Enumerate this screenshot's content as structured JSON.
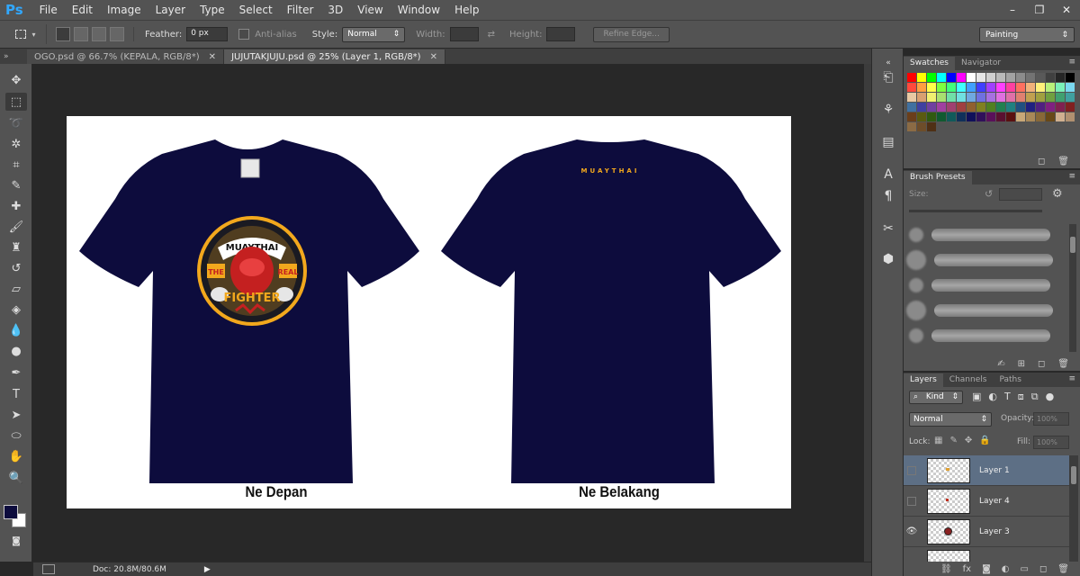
{
  "app": {
    "logo": "Ps"
  },
  "menu": [
    "File",
    "Edit",
    "Image",
    "Layer",
    "Type",
    "Select",
    "Filter",
    "3D",
    "View",
    "Window",
    "Help"
  ],
  "window_controls": {
    "minimize": "–",
    "restore": "❐",
    "close": "✕"
  },
  "options": {
    "feather_label": "Feather:",
    "feather_value": "0 px",
    "antialias_label": "Anti-alias",
    "style_label": "Style:",
    "style_value": "Normal",
    "width_label": "Width:",
    "height_label": "Height:",
    "refine_edge": "Refine Edge...",
    "workspace": "Painting"
  },
  "tabs": [
    {
      "label": "OGO.psd @ 66.7% (KEPALA, RGB/8*)",
      "active": false
    },
    {
      "label": "JUJUTAKJUJU.psd @ 25% (Layer 1, RGB/8*)",
      "active": true
    }
  ],
  "canvas": {
    "front_caption": "Ne Depan",
    "back_caption": "Ne Belakang",
    "back_print": "MUAYTHAI",
    "logo_top": "MUAYTHAI",
    "logo_left": "THE",
    "logo_right": "REAL",
    "logo_bottom": "FIGHTER",
    "shirt_color": "#0d0c3d"
  },
  "status": {
    "doc": "Doc: 20.8M/80.6M"
  },
  "panels": {
    "swatches_tab": "Swatches",
    "navigator_tab": "Navigator",
    "brush_presets_tab": "Brush Presets",
    "brush_size_label": "Size:",
    "layers_tab": "Layers",
    "channels_tab": "Channels",
    "paths_tab": "Paths",
    "kind_filter": "Kind",
    "blend_mode": "Normal",
    "opacity_label": "Opacity:",
    "opacity_value": "100%",
    "lock_label": "Lock:",
    "fill_label": "Fill:",
    "fill_value": "100%"
  },
  "layers": [
    {
      "name": "Layer 1",
      "visible": false,
      "selected": true
    },
    {
      "name": "Layer 4",
      "visible": false,
      "selected": false
    },
    {
      "name": "Layer 3",
      "visible": true,
      "selected": false
    }
  ],
  "swatches": [
    "#ff0000",
    "#ffff00",
    "#00ff00",
    "#00ffff",
    "#0000ff",
    "#ff00ff",
    "#ffffff",
    "#e6e6e6",
    "#d0d0d0",
    "#bababa",
    "#a3a3a3",
    "#8c8c8c",
    "#737373",
    "#595959",
    "#404040",
    "#262626",
    "#000000",
    "#ff4a3d",
    "#ffa040",
    "#ffff4a",
    "#7dff40",
    "#40ff7d",
    "#40ffff",
    "#40a0ff",
    "#4040ff",
    "#a040ff",
    "#ff40ff",
    "#ff40a0",
    "#ff7060",
    "#f2b27a",
    "#fff07a",
    "#b8f07a",
    "#7af0b8",
    "#7ad8f0",
    "#e8c9a3",
    "#d8a070",
    "#f0f070",
    "#a8e070",
    "#70e0a8",
    "#70e0e0",
    "#70a8e0",
    "#7070e0",
    "#a870e0",
    "#e070e0",
    "#e070a8",
    "#e08070",
    "#c0a050",
    "#a0a040",
    "#70a040",
    "#40a070",
    "#40a0a0",
    "#4070a0",
    "#4040a0",
    "#7040a0",
    "#a040a0",
    "#a04070",
    "#a04040",
    "#906030",
    "#808020",
    "#508020",
    "#208050",
    "#208080",
    "#205080",
    "#202080",
    "#502080",
    "#802080",
    "#802050",
    "#802020",
    "#6a3e1a",
    "#5a5a10",
    "#305a10",
    "#105a30",
    "#105a5a",
    "#10305a",
    "#10105a",
    "#30105a",
    "#5a105a",
    "#5a1030",
    "#5a1010",
    "#c8a878",
    "#a88858",
    "#886838",
    "#684818",
    "#d0b090",
    "#b09070",
    "#8b6b45",
    "#6d4d2a",
    "#4f3015"
  ]
}
